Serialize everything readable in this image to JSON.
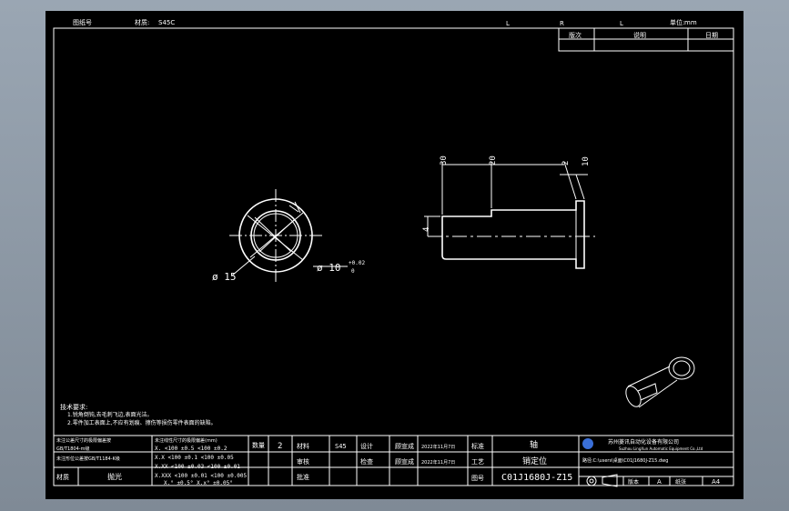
{
  "header": {
    "left_label": "图纸号",
    "mid_label": "材质:",
    "mid_value": "S45C",
    "markers": [
      "L",
      "R",
      "L"
    ],
    "right_label": "单位:",
    "right_value": "mm"
  },
  "revision_table": {
    "columns": [
      "版次",
      "说明",
      "日期"
    ]
  },
  "views": {
    "end_view": {
      "outer_dia": "ø 15",
      "inner_dia": "ø 10",
      "tol_upper": "+0.02",
      "tol_lower": "0"
    },
    "side_view": {
      "dim_30": "30",
      "dim_20": "20",
      "dim_2": "2",
      "dim_10": "10",
      "dim_4": "4"
    }
  },
  "notes": {
    "title": "技术要求:",
    "items": [
      "1.锐角倒钝,去毛刺飞边,表面光洁。",
      "2.零件加工表面上,不应有划痕、擦伤等损伤零件表面的缺陷。"
    ]
  },
  "tolerance_table": {
    "left_rows": [
      "未注公差尺寸的极限偏差按",
      "GB/T1804-m级",
      "未注形位公差按GB/T1184-K级"
    ],
    "heading": "未注线性尺寸的极限偏差(mm)",
    "rows": [
      "X.   <100 ±0.5  <100 ±0.2",
      "X.X  <100 ±0.1  <100 ±0.05",
      "X.XX <100 ±0.03 <100 ±0.01",
      "X.XXX <100 ±0.01 <100 ±0.005",
      "X.°  ±0.5°      X.x° ±0.05°"
    ],
    "material_label": "材质",
    "material_value": "抛光"
  },
  "title_block": {
    "qty_label": "数量",
    "qty_value": "2",
    "material_label": "材料",
    "material_value": "S45",
    "design_label": "设计",
    "design_name": "顾宣成",
    "design_date": "2022年11月7日",
    "std_label": "标准",
    "review_label": "审核",
    "check_label": "检查",
    "check_name": "顾宣成",
    "check_date": "2022年11月7日",
    "process_label": "工艺",
    "approve_label": "批准",
    "part_name": "轴",
    "part_name_2": "销定位",
    "drawing_no_label": "图号",
    "drawing_no": "C01J1680J-Z15",
    "company_cn": "苏州菱讯自动化设备有限公司",
    "company_en": "Suzhou LingXun Automatic Equipment Co.,Ltd",
    "file_path": "路径:C:\\users\\桌面\\C01J1680J-Z15.dwg",
    "version_label": "版本",
    "version_value": "A",
    "size_label": "纸张",
    "size_value": "A4"
  }
}
